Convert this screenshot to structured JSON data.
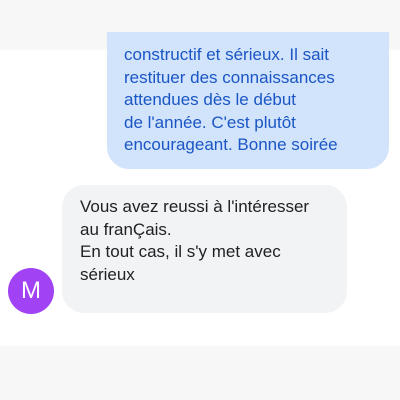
{
  "conversation": {
    "outgoing_message": {
      "text": "constructif et sérieux. Il sait\nrestituer des connaissances\nattendues dès le début\nde l'année. C'est plutôt\nencourageant. Bonne soirée"
    },
    "incoming_message": {
      "text": "Vous avez reussi à l'intéresser\nau franÇais.\nEn tout cas, il s'y met avec\nsérieux",
      "sender_initial": "M",
      "avatar_color": "#a142f4"
    }
  },
  "colors": {
    "outgoing_bubble": "#d2e3fc",
    "outgoing_text": "#1a56c4",
    "incoming_bubble": "#f1f3f4",
    "incoming_text": "#202124",
    "band": "#f7f7f7"
  }
}
